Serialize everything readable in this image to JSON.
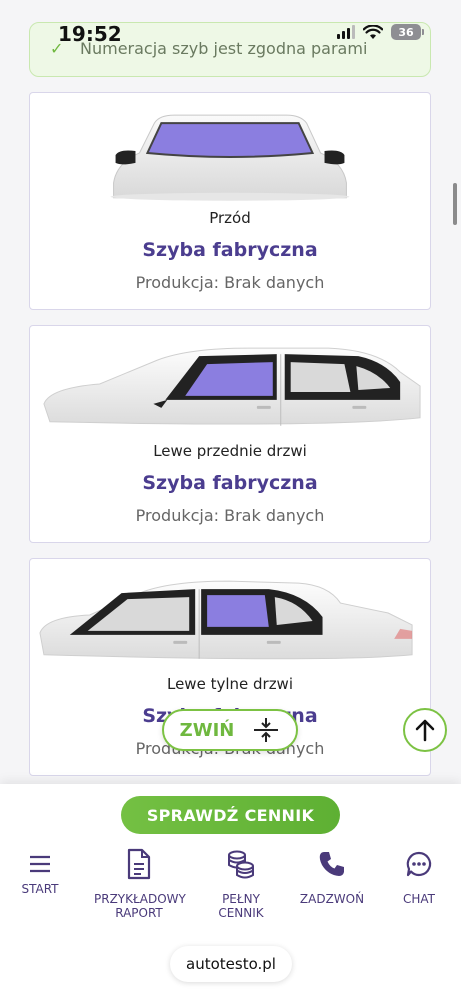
{
  "status": {
    "time": "19:52",
    "battery": "36"
  },
  "banner": {
    "text": "Numeracja szyb jest zgodna parami"
  },
  "cards": [
    {
      "position": "Przód",
      "type": "Szyba fabryczna",
      "production": "Produkcja: Brak danych"
    },
    {
      "position": "Lewe przednie drzwi",
      "type": "Szyba fabryczna",
      "production": "Produkcja: Brak danych"
    },
    {
      "position": "Lewe tylne drzwi",
      "type": "Szyba fabryczna",
      "production": "Produkcja: Brak danych"
    }
  ],
  "float": {
    "collapse_label": "ZWIŃ"
  },
  "bottom": {
    "cta_label": "SPRAWDŹ CENNIK",
    "nav": [
      {
        "label": "START",
        "icon": "menu-icon"
      },
      {
        "label": "PRZYKŁADOWY\nRAPORT",
        "icon": "document-icon"
      },
      {
        "label": "PEŁNY\nCENNIK",
        "icon": "coins-icon"
      },
      {
        "label": "ZADZWOŃ",
        "icon": "phone-icon"
      },
      {
        "label": "CHAT",
        "icon": "chat-icon"
      }
    ],
    "url": "autotesto.pl"
  },
  "colors": {
    "brand_green": "#6fb83f",
    "brand_purple": "#4b3d8f",
    "glass_highlight": "#8b7ee0"
  }
}
